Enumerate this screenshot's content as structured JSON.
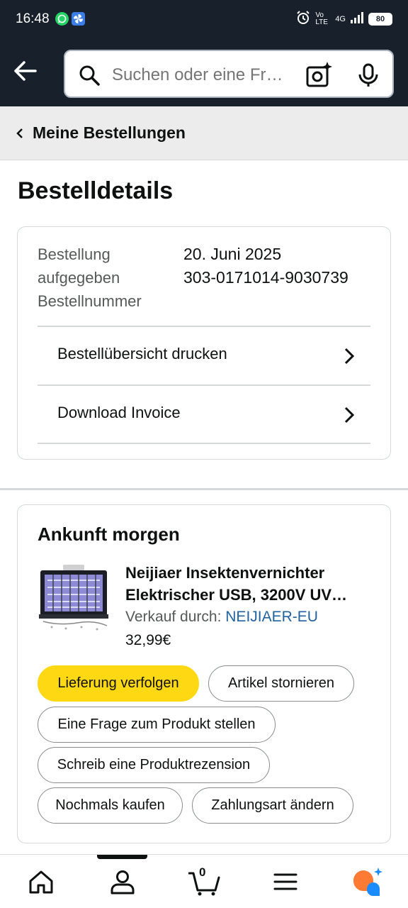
{
  "status_bar": {
    "time": "16:48",
    "apps": [
      "whatsapp-icon",
      "pinwheel-app-icon"
    ],
    "network_label": "Vo LTE",
    "network_type": "4G",
    "battery": "80"
  },
  "search": {
    "placeholder": "Suchen oder eine Fr…"
  },
  "breadcrumb": {
    "label": "Meine Bestellungen"
  },
  "page": {
    "title": "Bestelldetails"
  },
  "order": {
    "placed_label": "Bestellung aufgegeben",
    "placed_value": "20. Juni 2025",
    "number_label": "Bestellnummer",
    "number_value": "303-0171014-9030739",
    "links": [
      {
        "label": "Bestellübersicht drucken"
      },
      {
        "label": "Download Invoice"
      }
    ]
  },
  "delivery": {
    "title": "Ankunft morgen",
    "product": {
      "title_line1": "Neijiaer Insektenvernichter",
      "title_line2": "Elektrischer USB, 3200V UV…",
      "seller_prefix": "Verkauf durch:",
      "seller_name": "NEIJIAER-EU",
      "price": "32,99€"
    },
    "actions": [
      {
        "label": "Lieferung verfolgen",
        "primary": true
      },
      {
        "label": "Artikel stornieren",
        "primary": false
      },
      {
        "label": "Eine Frage zum Produkt stellen",
        "primary": false
      },
      {
        "label": "Schreib eine Produktrezension",
        "primary": false
      },
      {
        "label": "Nochmals kaufen",
        "primary": false
      },
      {
        "label": "Zahlungsart ändern",
        "primary": false
      }
    ]
  },
  "bottom_nav": {
    "items": [
      "home-icon",
      "account-icon",
      "cart-icon",
      "menu-icon",
      "rufus-assistant-icon"
    ],
    "cart_count": "0"
  },
  "colors": {
    "header_bg": "#18202b",
    "primary_button": "#ffd814",
    "link": "#2162a1",
    "border": "#d5d9d9"
  }
}
